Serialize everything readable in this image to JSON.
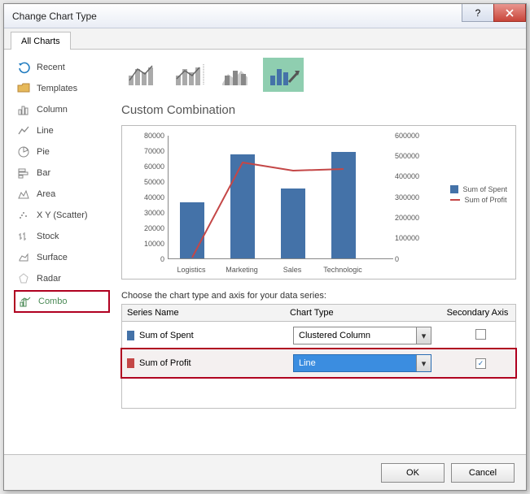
{
  "window": {
    "title": "Change Chart Type"
  },
  "tabs": {
    "all": "All Charts"
  },
  "sidebar": {
    "recent": "Recent",
    "templates": "Templates",
    "column": "Column",
    "line": "Line",
    "pie": "Pie",
    "bar": "Bar",
    "area": "Area",
    "xy": "X Y (Scatter)",
    "stock": "Stock",
    "surface": "Surface",
    "radar": "Radar",
    "combo": "Combo"
  },
  "subtitle": "Custom Combination",
  "legend": {
    "spent": "Sum of Spent",
    "profit": "Sum of Profit"
  },
  "choose_label": "Choose the chart type and axis for your data series:",
  "grid": {
    "head_series": "Series Name",
    "head_type": "Chart Type",
    "head_axis": "Secondary Axis",
    "row1_name": "Sum of Spent",
    "row1_type": "Clustered Column",
    "row2_name": "Sum of Profit",
    "row2_type": "Line"
  },
  "buttons": {
    "ok": "OK",
    "cancel": "Cancel"
  },
  "chart_data": {
    "type": "combo",
    "categories": [
      "Logistics",
      "Marketing",
      "Sales",
      "Technologic"
    ],
    "series": [
      {
        "name": "Sum of Spent",
        "type": "bar",
        "axis": "primary",
        "values": [
          37000,
          68000,
          46000,
          70000
        ]
      },
      {
        "name": "Sum of Profit",
        "type": "line",
        "axis": "secondary",
        "values": [
          10000,
          470000,
          430000,
          440000
        ]
      }
    ],
    "ylim_primary": [
      0,
      80000
    ],
    "ylim_secondary": [
      0,
      600000
    ],
    "y_ticks_primary": [
      0,
      10000,
      20000,
      30000,
      40000,
      50000,
      60000,
      70000,
      80000
    ],
    "y_ticks_secondary": [
      0,
      100000,
      200000,
      300000,
      400000,
      500000,
      600000
    ]
  },
  "colors": {
    "bar": "#4472a8",
    "line": "#c44747",
    "highlight": "#b00020",
    "select_bg": "#3b8de0"
  }
}
